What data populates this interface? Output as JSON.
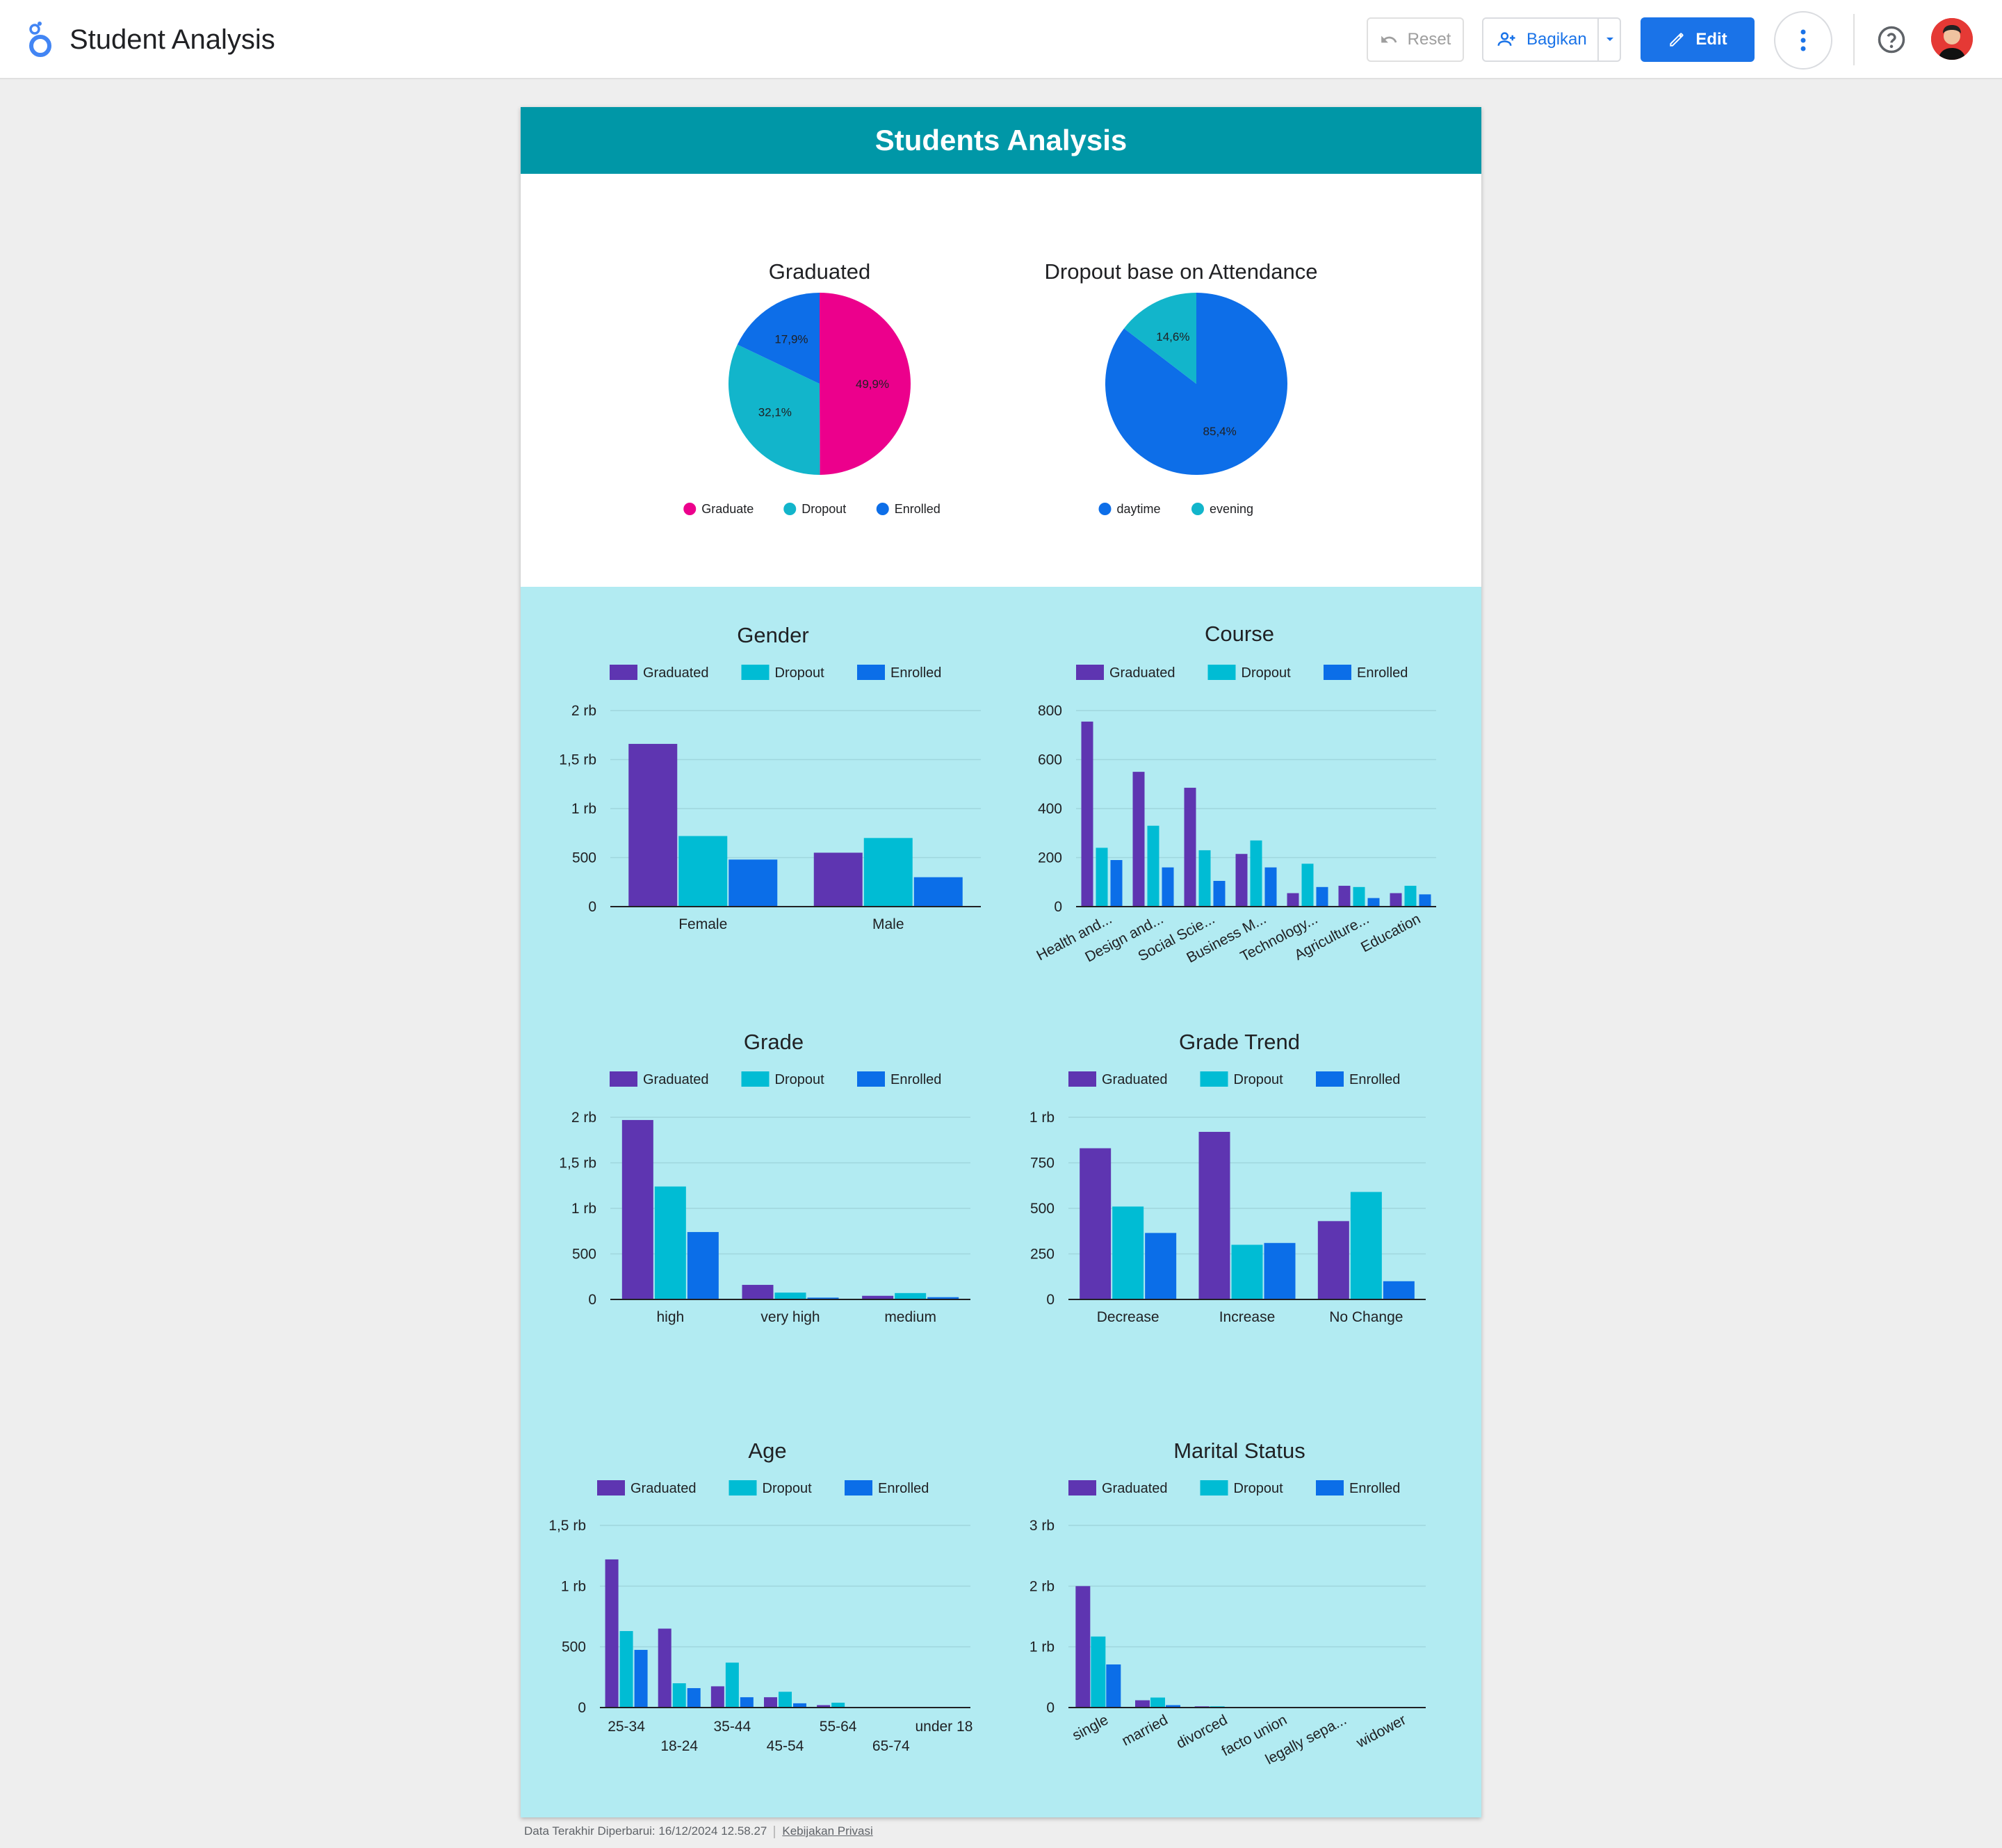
{
  "app": {
    "title": "Student Analysis",
    "reset_label": "Reset",
    "share_label": "Bagikan",
    "edit_label": "Edit"
  },
  "report": {
    "title": "Students Analysis"
  },
  "colors": {
    "graduated": "#5e35b1",
    "dropout": "#00bcd4",
    "enrolled": "#0b6ee8",
    "pie_graduate": "#ec008c",
    "pie_dropout": "#12b5cb",
    "pie_enrolled": "#0d6ee8",
    "pie_daytime": "#0d6ee8",
    "pie_evening": "#12b5cb"
  },
  "footer": {
    "updated": "Data Terakhir Diperbarui: 16/12/2024 12.58.27",
    "privacy": "Kebijakan Privasi"
  },
  "chart_data": [
    {
      "id": "graduated",
      "type": "pie",
      "title": "Graduated",
      "slices": [
        {
          "label": "Graduate",
          "value": 49.9,
          "display": "49,9%",
          "color": "#ec008c"
        },
        {
          "label": "Dropout",
          "value": 32.1,
          "display": "32,1%",
          "color": "#12b5cb"
        },
        {
          "label": "Enrolled",
          "value": 17.9,
          "display": "17,9%",
          "color": "#0d6ee8"
        }
      ],
      "legend": "bottom"
    },
    {
      "id": "attendance",
      "type": "pie",
      "title": "Dropout base on Attendance",
      "slices": [
        {
          "label": "daytime",
          "value": 85.4,
          "display": "85,4%",
          "color": "#0d6ee8"
        },
        {
          "label": "evening",
          "value": 14.6,
          "display": "14,6%",
          "color": "#12b5cb"
        }
      ],
      "legend": "bottom"
    },
    {
      "id": "gender",
      "type": "bar",
      "title": "Gender",
      "categories": [
        "Female",
        "Male"
      ],
      "series": [
        {
          "name": "Graduated",
          "values": [
            1660,
            550
          ]
        },
        {
          "name": "Dropout",
          "values": [
            720,
            700
          ]
        },
        {
          "name": "Enrolled",
          "values": [
            480,
            300
          ]
        }
      ],
      "ylim": [
        0,
        2000
      ],
      "yticks": [
        0,
        500,
        1000,
        1500,
        2000
      ],
      "ytick_labels": [
        "0",
        "500",
        "1 rb",
        "1,5 rb",
        "2 rb"
      ],
      "legend": "top",
      "grid": true
    },
    {
      "id": "course",
      "type": "bar",
      "title": "Course",
      "categories": [
        "Health and...",
        "Design and...",
        "Social Scie...",
        "Business M...",
        "Technology...",
        "Agriculture...",
        "Education"
      ],
      "series": [
        {
          "name": "Graduated",
          "values": [
            755,
            550,
            485,
            215,
            55,
            85,
            55
          ]
        },
        {
          "name": "Dropout",
          "values": [
            240,
            330,
            230,
            270,
            175,
            80,
            85
          ]
        },
        {
          "name": "Enrolled",
          "values": [
            190,
            160,
            105,
            160,
            80,
            35,
            50
          ]
        }
      ],
      "ylim": [
        0,
        800
      ],
      "yticks": [
        0,
        200,
        400,
        600,
        800
      ],
      "ytick_labels": [
        "0",
        "200",
        "400",
        "600",
        "800"
      ],
      "rotated_labels": true,
      "legend": "top",
      "grid": true
    },
    {
      "id": "grade",
      "type": "bar",
      "title": "Grade",
      "categories": [
        "high",
        "very high",
        "medium"
      ],
      "series": [
        {
          "name": "Graduated",
          "values": [
            1970,
            160,
            40
          ]
        },
        {
          "name": "Dropout",
          "values": [
            1240,
            75,
            70
          ]
        },
        {
          "name": "Enrolled",
          "values": [
            740,
            20,
            25
          ]
        }
      ],
      "ylim": [
        0,
        2000
      ],
      "yticks": [
        0,
        500,
        1000,
        1500,
        2000
      ],
      "ytick_labels": [
        "0",
        "500",
        "1 rb",
        "1,5 rb",
        "2 rb"
      ],
      "legend": "top",
      "grid": true
    },
    {
      "id": "grade-trend",
      "type": "bar",
      "title": "Grade Trend",
      "categories": [
        "Decrease",
        "Increase",
        "No Change"
      ],
      "series": [
        {
          "name": "Graduated",
          "values": [
            830,
            920,
            430
          ]
        },
        {
          "name": "Dropout",
          "values": [
            510,
            300,
            590
          ]
        },
        {
          "name": "Enrolled",
          "values": [
            365,
            310,
            100
          ]
        }
      ],
      "ylim": [
        0,
        1000
      ],
      "yticks": [
        0,
        250,
        500,
        750,
        1000
      ],
      "ytick_labels": [
        "0",
        "250",
        "500",
        "750",
        "1 rb"
      ],
      "legend": "top",
      "grid": true
    },
    {
      "id": "age",
      "type": "bar",
      "title": "Age",
      "categories": [
        "25-34",
        "18-24",
        "35-44",
        "45-54",
        "55-64",
        "65-74",
        "under 18"
      ],
      "series": [
        {
          "name": "Graduated",
          "values": [
            1220,
            650,
            175,
            85,
            20,
            0,
            0
          ]
        },
        {
          "name": "Dropout",
          "values": [
            630,
            200,
            370,
            130,
            40,
            0,
            0
          ]
        },
        {
          "name": "Enrolled",
          "values": [
            475,
            160,
            85,
            35,
            5,
            0,
            0
          ]
        }
      ],
      "ylim": [
        0,
        1500
      ],
      "yticks": [
        0,
        500,
        1000,
        1500
      ],
      "ytick_labels": [
        "0",
        "500",
        "1 rb",
        "1,5 rb"
      ],
      "staggered_labels": true,
      "legend": "top",
      "grid": true
    },
    {
      "id": "marital",
      "type": "bar",
      "title": "Marital Status",
      "categories": [
        "single",
        "married",
        "divorced",
        "facto union",
        "legally sepa...",
        "widower"
      ],
      "series": [
        {
          "name": "Graduated",
          "values": [
            2000,
            120,
            20,
            0,
            0,
            0
          ]
        },
        {
          "name": "Dropout",
          "values": [
            1170,
            165,
            20,
            0,
            0,
            0
          ]
        },
        {
          "name": "Enrolled",
          "values": [
            710,
            40,
            10,
            0,
            0,
            0
          ]
        }
      ],
      "ylim": [
        0,
        3000
      ],
      "yticks": [
        0,
        1000,
        2000,
        3000
      ],
      "ytick_labels": [
        "0",
        "1 rb",
        "2 rb",
        "3 rb"
      ],
      "rotated_labels": true,
      "legend": "top",
      "grid": true
    }
  ]
}
